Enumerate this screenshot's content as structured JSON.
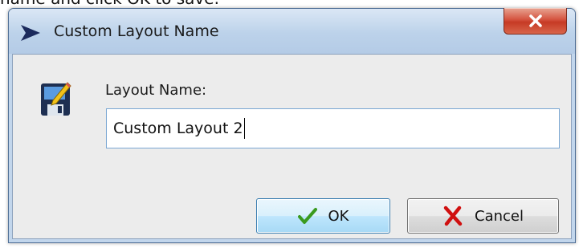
{
  "background_text": "name and click OK to save.",
  "window": {
    "title": "Custom Layout Name",
    "close_label": "close"
  },
  "form": {
    "label": "Layout Name:",
    "value": "Custom Layout 2"
  },
  "buttons": {
    "ok_label": "OK",
    "cancel_label": "Cancel"
  },
  "icons": {
    "app": "arrow-icon",
    "layout": "save-edit-icon",
    "ok": "checkmark-icon",
    "cancel": "red-x-icon",
    "close": "close-icon"
  },
  "colors": {
    "title_bar": "#bcd2ea",
    "close_button": "#c63a25",
    "ok_button": "#bee6fd",
    "checkmark": "#3a9a1e",
    "cancel_x": "#d01010",
    "input_border": "#7aa7d3"
  }
}
